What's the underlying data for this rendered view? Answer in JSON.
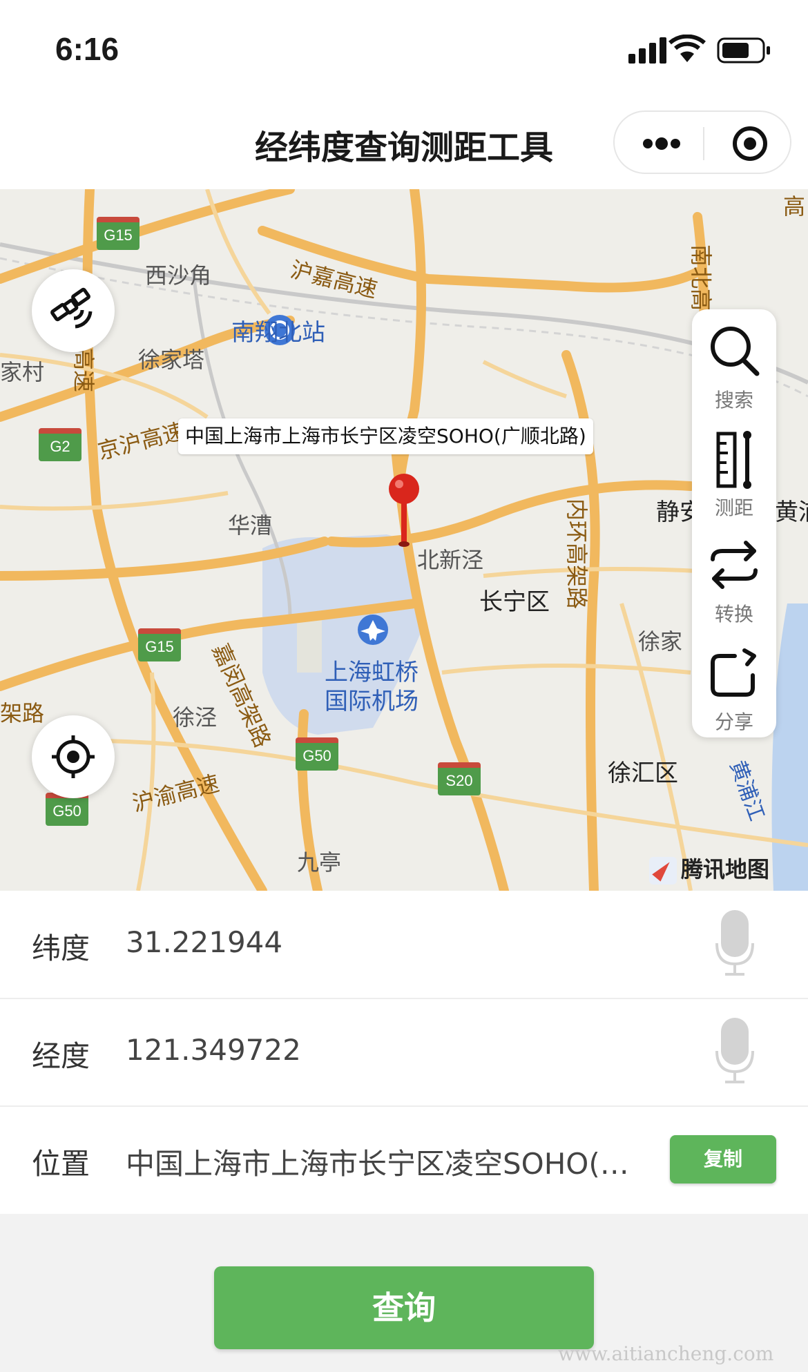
{
  "status": {
    "time": "6:16"
  },
  "nav": {
    "title": "经纬度查询测距工具"
  },
  "map": {
    "callout": "中国上海市上海市长宁区凌空SOHO(广顺北路)",
    "labels": {
      "xishajiao": "西沙角",
      "xujiata": "徐家塔",
      "nanxiang_north": "南翔北站",
      "huacao": "华漕",
      "beixinjing": "北新泾",
      "changning": "长宁区",
      "airport_l1": "上海虹桥",
      "airport_l2": "国际机场",
      "xujing": "徐泾",
      "jiuting": "九亭",
      "xuhui": "徐汇区",
      "xujia": "徐家",
      "jingan": "静安",
      "huang": "黄浦",
      "jiacun": "家村",
      "hujia": "沪嘉高速",
      "jinghu": "京沪高速",
      "huyu": "沪渝高速",
      "jiamin": "嘉闵高架路",
      "neihuan": "内环高架路",
      "nanbei": "南北高",
      "huangpu_river": "黄浦江",
      "gao_left": "高速",
      "lu_left": "架路",
      "gao_right": "高"
    },
    "shields": {
      "g15a": "G15",
      "g2": "G2",
      "g15b": "G15",
      "g50a": "G50",
      "g50b": "G50",
      "s20": "S20"
    },
    "logo": "腾讯地图"
  },
  "tools": {
    "search": "搜索",
    "measure": "测距",
    "convert": "转换",
    "share": "分享"
  },
  "form": {
    "lat_label": "纬度",
    "lat_value": "31.221944",
    "lng_label": "经度",
    "lng_value": "121.349722",
    "loc_label": "位置",
    "loc_value": "中国上海市上海市长宁区凌空SOHO(广顺北路)",
    "copy_label": "复制"
  },
  "query_label": "查询",
  "watermark": "www.aitiancheng.com",
  "colors": {
    "accent": "#5eb55b",
    "pin": "#d9261c"
  }
}
